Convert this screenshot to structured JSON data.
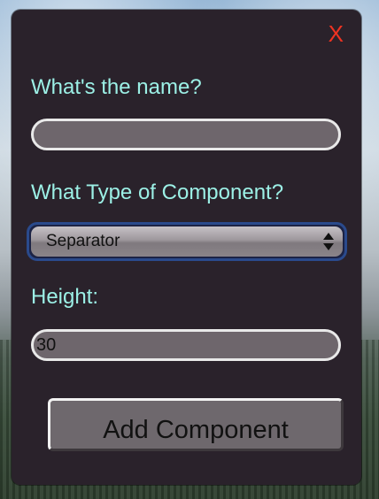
{
  "dialog": {
    "close_label": "X",
    "name_field": {
      "label": "What's the name?",
      "value": "",
      "placeholder": ""
    },
    "type_field": {
      "label": "What Type of Component?",
      "selected": "Separator"
    },
    "height_field": {
      "label": "Height:",
      "value": "30"
    },
    "submit_label": "Add Component"
  },
  "colors": {
    "dialog_bg": "#2a222b",
    "label": "#9cf0e6",
    "close": "#ee3322",
    "select_focus": "#2a4a8c"
  }
}
